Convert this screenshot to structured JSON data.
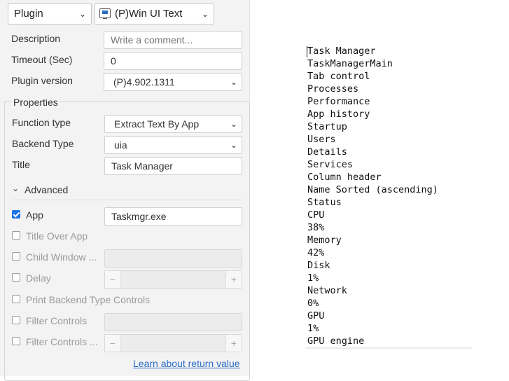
{
  "header": {
    "plugin_select": "Plugin",
    "action_select": "(P)Win UI Text"
  },
  "fields": {
    "description_label": "Description",
    "description_placeholder": "Write a comment...",
    "timeout_label": "Timeout (Sec)",
    "timeout_value": "0",
    "plugin_version_label": "Plugin version",
    "plugin_version_value": "(P)4.902.1311"
  },
  "properties": {
    "title": "Properties",
    "function_type_label": "Function type",
    "function_type_value": "Extract Text By App",
    "backend_type_label": "Backend Type",
    "backend_type_value": "uia",
    "title_label": "Title",
    "title_value": "Task Manager",
    "advanced_label": "Advanced",
    "app_label": "App",
    "app_value": "Taskmgr.exe",
    "title_over_app_label": "Title Over App",
    "child_window_label": "Child Window ...",
    "delay_label": "Delay",
    "print_backend_label": "Print Backend Type Controls",
    "filter_controls_label": "Filter Controls",
    "filter_controls2_label": "Filter Controls ...",
    "return_link": "Learn about return value",
    "stepper_minus": "−",
    "stepper_plus": "+"
  },
  "output_lines": [
    "Task Manager",
    "TaskManagerMain",
    "Tab control",
    "Processes",
    "Performance",
    "App history",
    "Startup",
    "Users",
    "Details",
    "Services",
    "Column header",
    "Name Sorted (ascending)",
    "Status",
    "CPU",
    "38%",
    "Memory",
    "42%",
    "Disk",
    "1%",
    "Network",
    "0%",
    "GPU",
    "1%",
    "GPU engine"
  ]
}
